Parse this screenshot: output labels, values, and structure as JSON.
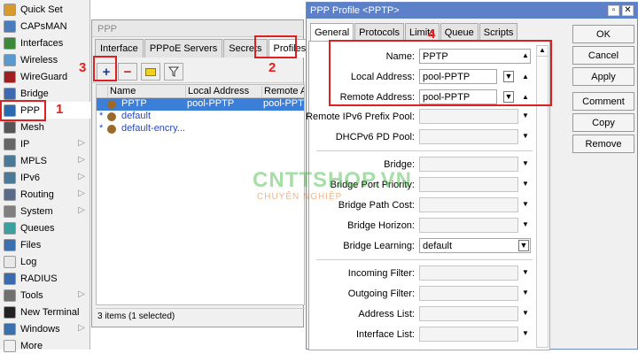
{
  "sidebar": {
    "items": [
      {
        "label": "Quick Set",
        "icon": "quickset-icon",
        "color": "#d89a2a"
      },
      {
        "label": "CAPsMAN",
        "icon": "capsman-icon",
        "color": "#4a7cc0"
      },
      {
        "label": "Interfaces",
        "icon": "interfaces-icon",
        "color": "#3a8a3a"
      },
      {
        "label": "Wireless",
        "icon": "wireless-icon",
        "color": "#5a9ad0"
      },
      {
        "label": "WireGuard",
        "icon": "wireguard-icon",
        "color": "#a02020"
      },
      {
        "label": "Bridge",
        "icon": "bridge-icon",
        "color": "#3c6ab0"
      },
      {
        "label": "PPP",
        "icon": "ppp-icon",
        "color": "#2a6ab0"
      },
      {
        "label": "Mesh",
        "icon": "mesh-icon",
        "color": "#555555"
      },
      {
        "label": "IP",
        "icon": "ip-icon",
        "color": "#666666"
      },
      {
        "label": "MPLS",
        "icon": "mpls-icon",
        "color": "#4a7a9a"
      },
      {
        "label": "IPv6",
        "icon": "ipv6-icon",
        "color": "#4a7a9a"
      },
      {
        "label": "Routing",
        "icon": "routing-icon",
        "color": "#5a6a8a"
      },
      {
        "label": "System",
        "icon": "system-icon",
        "color": "#808080"
      },
      {
        "label": "Queues",
        "icon": "queues-icon",
        "color": "#3aa0a0"
      },
      {
        "label": "Files",
        "icon": "files-icon",
        "color": "#3a70b0"
      },
      {
        "label": "Log",
        "icon": "log-icon",
        "color": "#e8e8e8"
      },
      {
        "label": "RADIUS",
        "icon": "radius-icon",
        "color": "#3a6ab0"
      },
      {
        "label": "Tools",
        "icon": "tools-icon",
        "color": "#707070"
      },
      {
        "label": "New Terminal",
        "icon": "terminal-icon",
        "color": "#222222"
      },
      {
        "label": "Windows",
        "icon": "windows-icon",
        "color": "#3a70b0"
      },
      {
        "label": "More",
        "icon": "more-icon",
        "color": "#f0f0f0"
      }
    ]
  },
  "annotations": {
    "n1": "1",
    "n2": "2",
    "n3": "3",
    "n4": "4"
  },
  "ppp": {
    "title": "PPP",
    "tabs": [
      "Interface",
      "PPPoE Servers",
      "Secrets",
      "Profiles",
      "A"
    ],
    "columns": [
      "Name",
      "Local Address",
      "Remote Ac"
    ],
    "rows": [
      {
        "flag": "",
        "name": "PPTP",
        "local": "pool-PPTP",
        "remote": "pool-PPTP"
      },
      {
        "flag": "*",
        "name": "default",
        "local": "",
        "remote": ""
      },
      {
        "flag": "*",
        "name": "default-encry...",
        "local": "",
        "remote": ""
      }
    ],
    "status": "3 items (1 selected)"
  },
  "dialog": {
    "title": "PPP Profile <PPTP>",
    "tabs": [
      "General",
      "Protocols",
      "Limits",
      "Queue",
      "Scripts"
    ],
    "fields": {
      "name_label": "Name:",
      "name_value": "PPTP",
      "local_label": "Local Address:",
      "local_value": "pool-PPTP",
      "remote_label": "Remote Address:",
      "remote_value": "pool-PPTP",
      "ipv6pool_label": "Remote IPv6 Prefix Pool:",
      "dhcpv6_label": "DHCPv6 PD Pool:",
      "bridge_label": "Bridge:",
      "bpp_label": "Bridge Port Priority:",
      "bpc_label": "Bridge Path Cost:",
      "bh_label": "Bridge Horizon:",
      "bl_label": "Bridge Learning:",
      "bl_value": "default",
      "if_label": "Incoming Filter:",
      "of_label": "Outgoing Filter:",
      "al_label": "Address List:",
      "il_label": "Interface List:"
    },
    "buttons": {
      "ok": "OK",
      "cancel": "Cancel",
      "apply": "Apply",
      "comment": "Comment",
      "copy": "Copy",
      "remove": "Remove"
    }
  },
  "watermark": {
    "brand": "CNTTSHOP.VN",
    "tagline": "CHUYÊN NGHIỆP"
  },
  "colors": {
    "annotation": "#e02020",
    "selection": "#3c7fd8",
    "titlebar": "#5c81c8"
  }
}
